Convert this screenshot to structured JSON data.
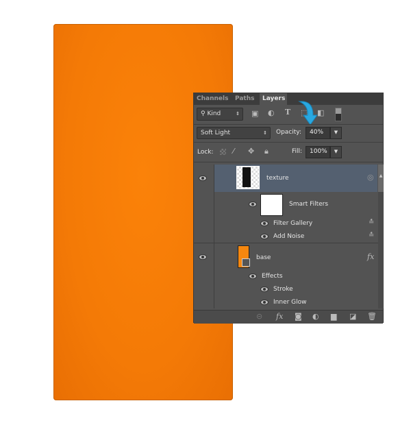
{
  "canvas": {
    "color": "#f57a06"
  },
  "panel": {
    "tabs": [
      {
        "label": "Channels"
      },
      {
        "label": "Paths"
      },
      {
        "label": "Layers",
        "active": true
      }
    ],
    "filter": {
      "label": "Kind"
    },
    "blend_mode": "Soft Light",
    "opacity": {
      "label": "Opacity:",
      "value": "40%"
    },
    "lock": {
      "label": "Lock:"
    },
    "fill": {
      "label": "Fill:",
      "value": "100%"
    },
    "layers": [
      {
        "name": "texture",
        "selected": true,
        "smart_filters": {
          "label": "Smart Filters",
          "items": [
            "Filter Gallery",
            "Add Noise"
          ]
        }
      },
      {
        "name": "base",
        "fx": "fx",
        "effects": {
          "label": "Effects",
          "items": [
            "Stroke",
            "Inner Glow"
          ]
        }
      }
    ],
    "highlight_color": "#546070",
    "arrow_color": "#29a8e0"
  }
}
